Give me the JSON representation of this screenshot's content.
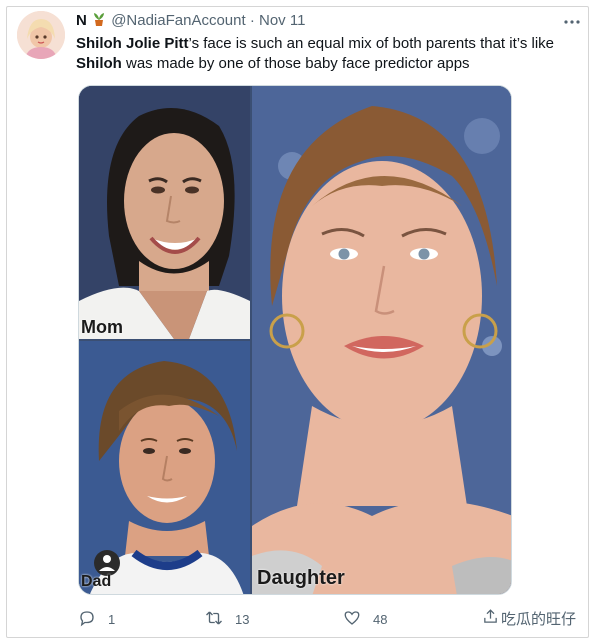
{
  "author": {
    "name": "N",
    "handle": "@NadiaFanAccount",
    "date": "Nov 11",
    "separator": "·"
  },
  "tweet": {
    "part1_bold": "Shiloh Jolie Pitt",
    "part1_rest": "’s face is such an equal mix of both parents that it’s like",
    "part2_bold": "Shiloh",
    "part2_rest": " was made by one of those baby face predictor apps"
  },
  "media": {
    "labels": {
      "mom": "Mom",
      "dad": "Dad",
      "daughter": "Daughter"
    }
  },
  "actions": {
    "reply_count": "1",
    "retweet_count": "13",
    "like_count": "48"
  },
  "watermark": {
    "text": "吃瓜的旺仔"
  },
  "icons": {
    "more": "more-dots-icon",
    "reply": "reply-icon",
    "retweet": "retweet-icon",
    "like": "heart-icon",
    "share": "share-icon",
    "plant": "potted-plant-emoji-icon"
  }
}
